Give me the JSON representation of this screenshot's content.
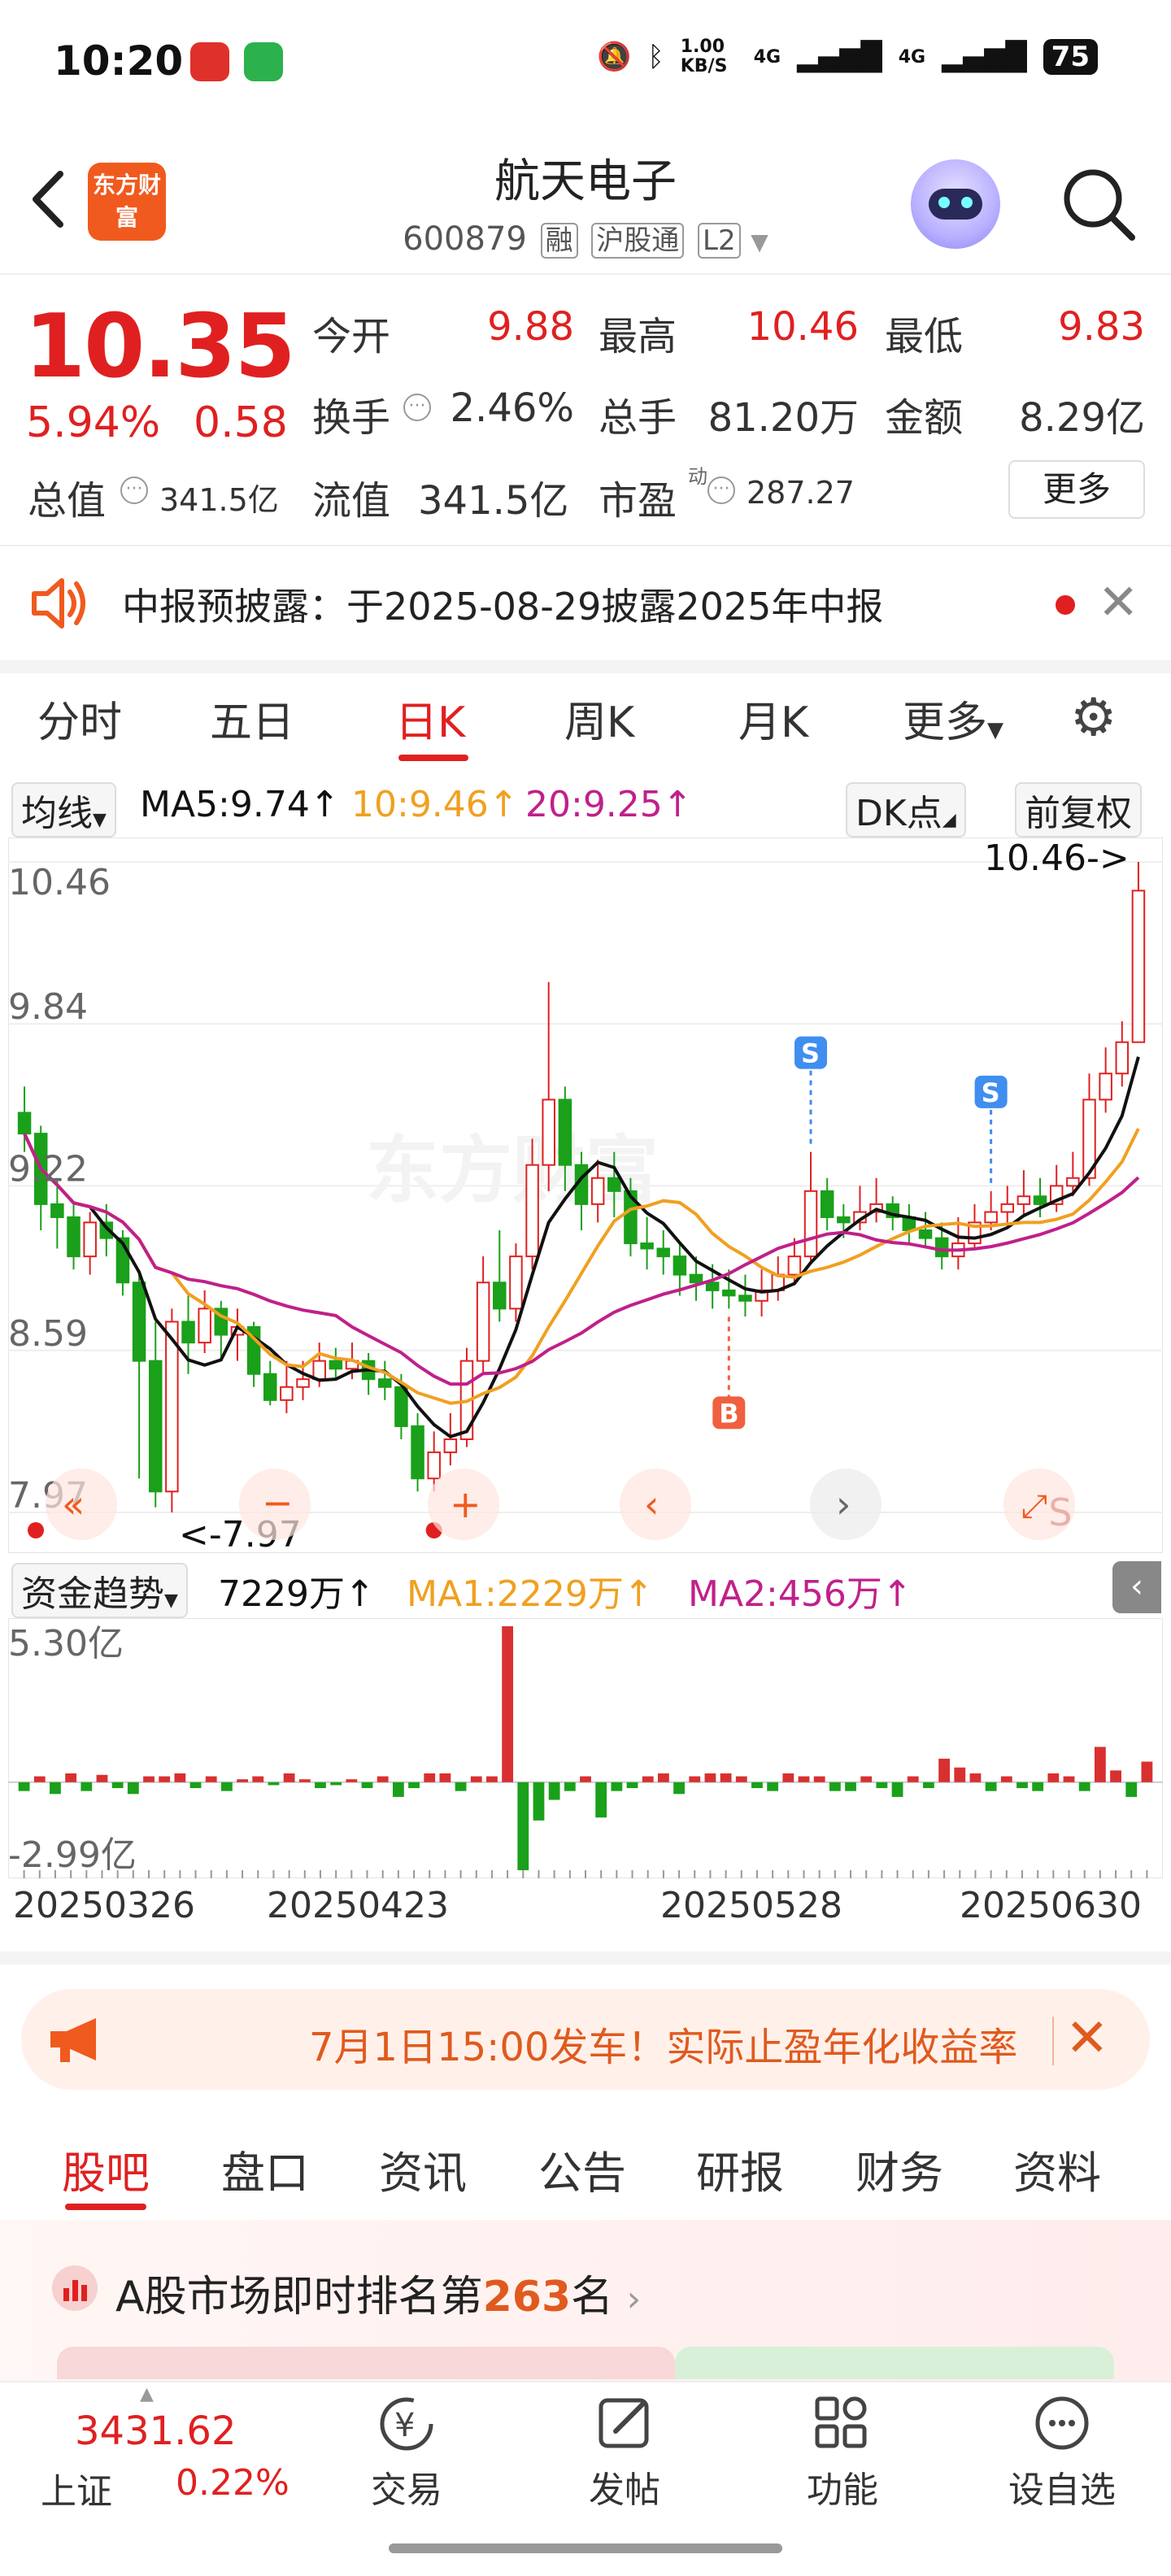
{
  "status_bar": {
    "time": "10:20",
    "net_speed": "1.00 KB/S",
    "signal1": "4G",
    "signal2": "4G",
    "battery": "75"
  },
  "header": {
    "back_icon": "chevron-left-icon",
    "logo_text": "东方财富",
    "name": "航天电子",
    "code": "600879",
    "tag_rong": "融",
    "tag_hgt": "沪股通",
    "tag_l2": "L2"
  },
  "quote": {
    "price": "10.35",
    "change_pct": "5.94%",
    "change": "0.58",
    "open_label": "今开",
    "open": "9.88",
    "high_label": "最高",
    "high": "10.46",
    "low_label": "最低",
    "low": "9.83",
    "turnover_label": "换手",
    "turnover": "2.46%",
    "volume_label": "总手",
    "volume": "81.20万",
    "amount_label": "金额",
    "amount": "8.29亿",
    "mcap_label": "总值",
    "mcap": "341.5亿",
    "float_label": "流值",
    "float": "341.5亿",
    "pe_label": "市盈",
    "pe_sup": "动",
    "pe": "287.27",
    "more": "更多"
  },
  "notice": {
    "text": "中报预披露：于2025-08-29披露2025年中报"
  },
  "chart_tabs": [
    "分时",
    "五日",
    "日K",
    "周K",
    "月K",
    "更多"
  ],
  "ma_row": {
    "selector": "均线",
    "ma5": "MA5:9.74↑",
    "ma10": "10:9.46↑",
    "ma20": "20:9.25↑",
    "dk": "DK点",
    "adjust": "前复权"
  },
  "fund_row": {
    "selector": "资金趋势",
    "value": "7229万↑",
    "ma1": "MA1:2229万↑",
    "ma2": "MA2:456万↑"
  },
  "chart_data": [
    {
      "type": "candlestick",
      "y_ticks": [
        "10.46",
        "9.84",
        "9.22",
        "8.59",
        "7.97"
      ],
      "ylim": [
        7.97,
        10.46
      ],
      "max_label": "10.46->",
      "min_label": "<-7.97",
      "candles": [
        [
          9.5,
          9.42,
          9.6,
          9.35
        ],
        [
          9.42,
          9.15,
          9.45,
          9.05
        ],
        [
          9.15,
          9.1,
          9.25,
          8.98
        ],
        [
          9.1,
          8.95,
          9.15,
          8.9
        ],
        [
          8.95,
          9.08,
          9.12,
          8.88
        ],
        [
          9.08,
          9.02,
          9.15,
          8.95
        ],
        [
          9.02,
          8.85,
          9.05,
          8.8
        ],
        [
          8.85,
          8.55,
          8.88,
          8.1
        ],
        [
          8.55,
          8.05,
          8.7,
          7.99
        ],
        [
          8.05,
          8.7,
          8.75,
          7.97
        ],
        [
          8.7,
          8.62,
          8.8,
          8.5
        ],
        [
          8.62,
          8.75,
          8.82,
          8.58
        ],
        [
          8.75,
          8.65,
          8.78,
          8.55
        ],
        [
          8.65,
          8.68,
          8.75,
          8.55
        ],
        [
          8.68,
          8.5,
          8.7,
          8.45
        ],
        [
          8.5,
          8.4,
          8.55,
          8.38
        ],
        [
          8.4,
          8.45,
          8.55,
          8.35
        ],
        [
          8.45,
          8.48,
          8.55,
          8.4
        ],
        [
          8.48,
          8.55,
          8.62,
          8.45
        ],
        [
          8.55,
          8.52,
          8.6,
          8.48
        ],
        [
          8.52,
          8.55,
          8.62,
          8.48
        ],
        [
          8.55,
          8.48,
          8.58,
          8.42
        ],
        [
          8.48,
          8.45,
          8.55,
          8.4
        ],
        [
          8.45,
          8.3,
          8.5,
          8.25
        ],
        [
          8.3,
          8.1,
          8.35,
          8.05
        ],
        [
          8.1,
          8.2,
          8.28,
          8.05
        ],
        [
          8.2,
          8.25,
          8.35,
          8.15
        ],
        [
          8.25,
          8.55,
          8.6,
          8.22
        ],
        [
          8.55,
          8.85,
          8.95,
          8.5
        ],
        [
          8.85,
          8.75,
          9.05,
          8.7
        ],
        [
          8.75,
          8.95,
          9.0,
          8.7
        ],
        [
          8.95,
          9.3,
          9.4,
          8.9
        ],
        [
          9.3,
          9.55,
          10.0,
          9.2
        ],
        [
          9.55,
          9.3,
          9.6,
          9.2
        ],
        [
          9.3,
          9.15,
          9.35,
          9.05
        ],
        [
          9.15,
          9.25,
          9.32,
          9.08
        ],
        [
          9.25,
          9.2,
          9.35,
          9.1
        ],
        [
          9.2,
          9.0,
          9.25,
          8.95
        ],
        [
          9.0,
          8.98,
          9.1,
          8.9
        ],
        [
          8.98,
          8.95,
          9.05,
          8.88
        ],
        [
          8.95,
          8.88,
          9.0,
          8.8
        ],
        [
          8.88,
          8.85,
          8.95,
          8.78
        ],
        [
          8.85,
          8.82,
          8.92,
          8.75
        ],
        [
          8.82,
          8.8,
          8.9,
          8.75
        ],
        [
          8.8,
          8.78,
          8.88,
          8.72
        ],
        [
          8.78,
          8.82,
          8.9,
          8.72
        ],
        [
          8.82,
          8.88,
          8.95,
          8.78
        ],
        [
          8.88,
          8.95,
          9.02,
          8.85
        ],
        [
          8.95,
          9.2,
          9.35,
          8.92
        ],
        [
          9.2,
          9.1,
          9.25,
          9.05
        ],
        [
          9.1,
          9.08,
          9.15,
          9.02
        ],
        [
          9.08,
          9.12,
          9.22,
          9.05
        ],
        [
          9.12,
          9.15,
          9.25,
          9.08
        ],
        [
          9.15,
          9.1,
          9.18,
          9.05
        ],
        [
          9.1,
          9.05,
          9.15,
          9.0
        ],
        [
          9.05,
          9.02,
          9.12,
          8.98
        ],
        [
          9.02,
          8.95,
          9.08,
          8.9
        ],
        [
          8.95,
          9.0,
          9.1,
          8.9
        ],
        [
          9.0,
          9.08,
          9.15,
          8.98
        ],
        [
          9.08,
          9.12,
          9.2,
          9.05
        ],
        [
          9.12,
          9.15,
          9.22,
          9.08
        ],
        [
          9.15,
          9.18,
          9.28,
          9.1
        ],
        [
          9.18,
          9.15,
          9.25,
          9.1
        ],
        [
          9.15,
          9.22,
          9.3,
          9.12
        ],
        [
          9.22,
          9.25,
          9.35,
          9.18
        ],
        [
          9.25,
          9.55,
          9.65,
          9.22
        ],
        [
          9.55,
          9.65,
          9.75,
          9.5
        ],
        [
          9.65,
          9.77,
          9.85,
          9.6
        ],
        [
          9.77,
          10.35,
          10.46,
          9.83
        ]
      ],
      "markers": [
        "S",
        "S",
        "B",
        "S"
      ]
    },
    {
      "type": "bar",
      "y_ticks": [
        "5.30亿",
        "-2.99亿"
      ],
      "ylim": [
        -2.99,
        5.3
      ],
      "x_ticks": [
        "20250326",
        "20250423",
        "20250528",
        "20250630"
      ],
      "values": [
        -0.3,
        0.2,
        -0.4,
        0.3,
        -0.3,
        0.25,
        -0.2,
        -0.4,
        0.2,
        0.2,
        0.3,
        -0.2,
        0.2,
        -0.3,
        0.1,
        0.2,
        -0.1,
        0.3,
        0.1,
        -0.2,
        -0.1,
        0.1,
        -0.2,
        0.2,
        -0.5,
        -0.2,
        0.3,
        0.3,
        -0.3,
        0.2,
        0.2,
        5.3,
        -2.99,
        -1.3,
        -0.6,
        -0.3,
        0.2,
        -1.2,
        -0.3,
        -0.2,
        0.2,
        0.3,
        -0.4,
        0.2,
        0.3,
        0.3,
        0.2,
        -0.2,
        -0.3,
        0.3,
        0.2,
        0.2,
        -0.3,
        -0.3,
        0.2,
        -0.2,
        -0.5,
        0.2,
        -0.2,
        0.8,
        0.5,
        0.3,
        -0.3,
        0.2,
        -0.2,
        -0.3,
        0.3,
        0.2,
        -0.3,
        1.2,
        0.4,
        -0.5,
        0.7
      ]
    }
  ],
  "ad": {
    "text": "7月1日15:00发车！实际止盈年化收益率"
  },
  "bottom_tabs": [
    "股吧",
    "盘口",
    "资讯",
    "公告",
    "研报",
    "财务",
    "资料"
  ],
  "rank": {
    "prefix": "A股市场即时排名第",
    "number": "263",
    "suffix": "名"
  },
  "index": {
    "value": "3431.62",
    "name": "上证",
    "pct": "0.22%"
  },
  "nav": [
    {
      "label": "交易",
      "icon": "yen-icon"
    },
    {
      "label": "发帖",
      "icon": "edit-icon"
    },
    {
      "label": "功能",
      "icon": "grid-icon"
    },
    {
      "label": "设自选",
      "icon": "chat-icon"
    }
  ],
  "colors": {
    "up": "#e02020",
    "down": "#1aa01a",
    "ma5": "#111111",
    "ma10": "#f0a020",
    "ma20": "#c0208a",
    "brand": "#f05a1e"
  }
}
